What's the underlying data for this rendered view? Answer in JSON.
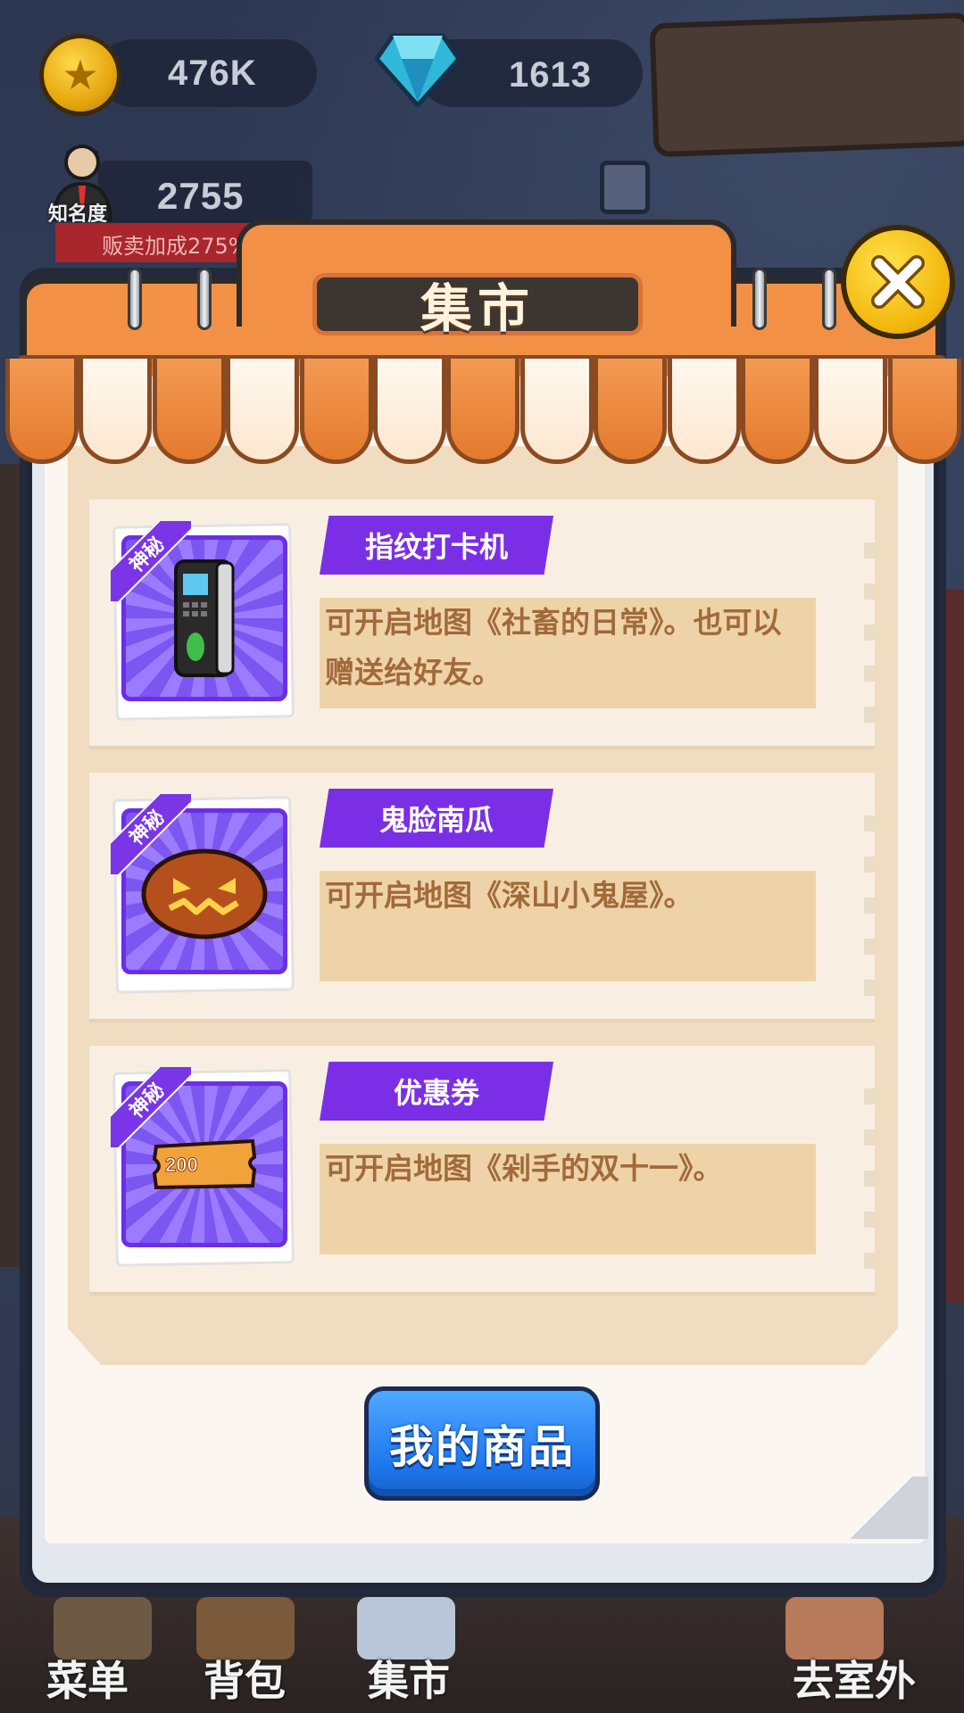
{
  "hud": {
    "coins": "476K",
    "gems": "1613",
    "fame_value": "2755",
    "fame_label": "知名度",
    "sell_bonus": "贩卖加成275%"
  },
  "modal": {
    "title": "集市",
    "items": [
      {
        "badge": "神秘",
        "name": "指纹打卡机",
        "description": "可开启地图《社畜的日常》。也可以赠送给好友。",
        "icon": "fingerprint-clock-icon"
      },
      {
        "badge": "神秘",
        "name": "鬼脸南瓜",
        "description": "可开启地图《深山小鬼屋》。",
        "icon": "ghost-pumpkin-icon"
      },
      {
        "badge": "神秘",
        "name": "优惠券",
        "description": "可开启地图《剁手的双十一》。",
        "icon": "coupon-icon",
        "coupon_text": "200"
      }
    ],
    "my_goods_button": "我的商品"
  },
  "bottom_nav": {
    "menu": "菜单",
    "backpack": "背包",
    "market": "集市",
    "go_outside": "去室外"
  },
  "colors": {
    "header_orange": "#f29145",
    "purple_tag": "#7a2fe6",
    "desc_bg": "#efd3a8",
    "button_blue": "#1f78ee",
    "close_gold": "#f2b50a"
  }
}
